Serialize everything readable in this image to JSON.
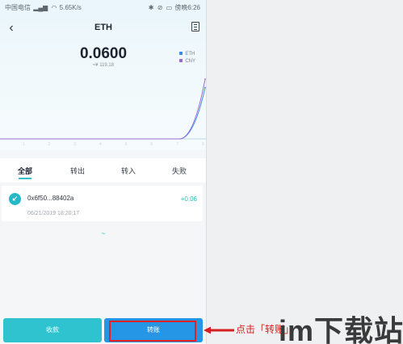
{
  "status_bar": {
    "carrier": "中国电信",
    "speed": "5.65K/s",
    "time_prefix": "傍晚",
    "time": "6:26"
  },
  "header": {
    "title": "ETH"
  },
  "balance": {
    "amount": "0.0600",
    "fiat": "≈¥ 119.18"
  },
  "legend": [
    {
      "label": "ETH",
      "color": "#3a8de0"
    },
    {
      "label": "CNY",
      "color": "#9a6ad8"
    }
  ],
  "chart_data": {
    "type": "line",
    "x": [
      0,
      1,
      2,
      3,
      4,
      5,
      6,
      7,
      8
    ],
    "series": [
      {
        "name": "ETH",
        "values": [
          0,
          0,
          0,
          0,
          0,
          0,
          0,
          0,
          0.06
        ]
      },
      {
        "name": "CNY",
        "values": [
          0,
          0,
          0,
          0,
          0,
          0,
          0,
          0,
          0.07
        ]
      }
    ],
    "ylim": [
      0,
      0.07
    ],
    "grid": false,
    "legend_position": "top-right"
  },
  "tabs": [
    "全部",
    "转出",
    "转入",
    "失败"
  ],
  "active_tab": 0,
  "transactions": [
    {
      "address": "0x6f50...88402a",
      "amount": "+0.06",
      "time": "06/21/2019 18:20:17"
    }
  ],
  "more_indicator": "~",
  "buttons": {
    "receive": "收款",
    "send": "转账"
  },
  "annotation": "点击「转账」",
  "watermark": "im下载站"
}
